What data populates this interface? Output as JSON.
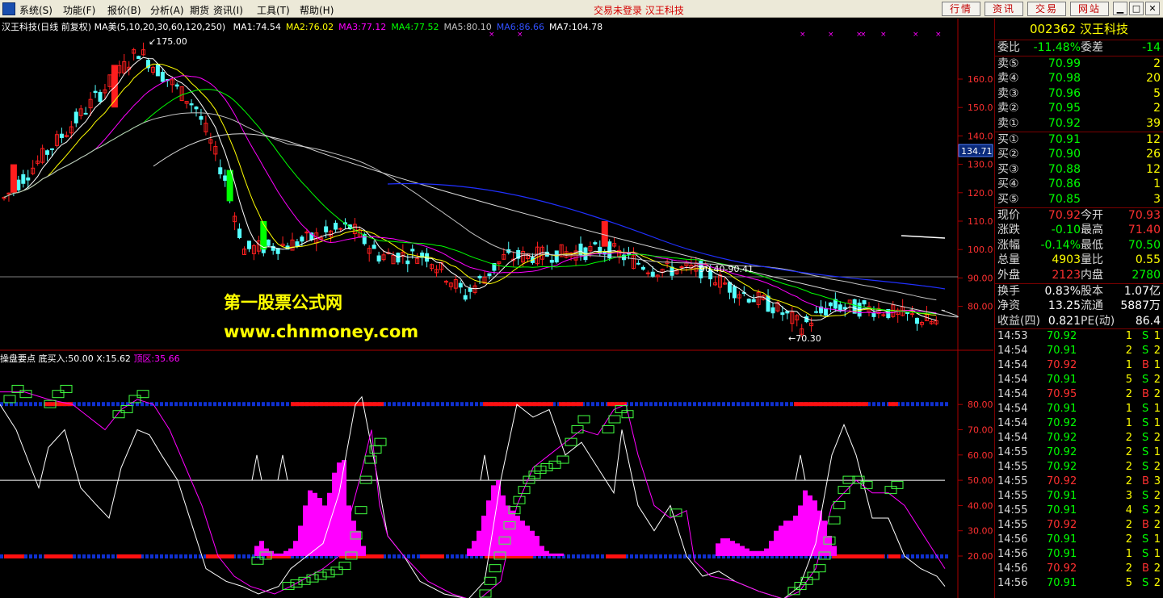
{
  "menu": {
    "items": [
      "系统(S)",
      "功能(F)",
      "报价(B)",
      "分析(A)",
      "期货",
      "资讯(I)",
      "工具(T)",
      "帮助(H)"
    ],
    "status": "交易未登录  汉王科技",
    "buttons": [
      "行情",
      "资讯",
      "交易",
      "网站"
    ]
  },
  "main_chart": {
    "title": "汉王科技(日线 前复权)",
    "ma_label": "MA美(5,10,20,30,60,120,250)",
    "ma_values": [
      {
        "label": "MA1:74.54",
        "color": "#ffffff"
      },
      {
        "label": "MA2:76.02",
        "color": "#ffff00"
      },
      {
        "label": "MA3:77.12",
        "color": "#ff00ff"
      },
      {
        "label": "MA4:77.52",
        "color": "#00ff00"
      },
      {
        "label": "MA5:80.10",
        "color": "#c0c0c0"
      },
      {
        "label": "MA6:86.66",
        "color": "#3050ff"
      },
      {
        "label": "MA7:104.78",
        "color": "#ffffff"
      }
    ],
    "high_marker": "175.00",
    "low_marker": "70.30",
    "band_label": "90.40-90.41",
    "current_price_tag": "134.71",
    "y_ticks": [
      "160.0",
      "150.0",
      "140.0",
      "130.0",
      "120.0",
      "110.0",
      "100.0",
      "90.00",
      "80.00"
    ]
  },
  "indicator": {
    "title": "操盘要点",
    "buy_label": "底买入:50.00",
    "x_label": "X:15.62",
    "top_label": "顶区:35.66",
    "y_ticks": [
      "80.00",
      "70.00",
      "60.00",
      "50.00",
      "40.00",
      "30.00",
      "20.00"
    ]
  },
  "watermark": {
    "line1": "第一股票公式网",
    "line2": "www.chnmoney.com"
  },
  "quote": {
    "code": "002362",
    "name": "汉王科技",
    "ratio": {
      "label": "委比",
      "value": "-11.48%",
      "label2": "委差",
      "value2": "-14"
    },
    "sells": [
      {
        "label": "卖⑤",
        "price": "70.99",
        "vol": "2"
      },
      {
        "label": "卖④",
        "price": "70.98",
        "vol": "20"
      },
      {
        "label": "卖③",
        "price": "70.96",
        "vol": "5"
      },
      {
        "label": "卖②",
        "price": "70.95",
        "vol": "2"
      },
      {
        "label": "卖①",
        "price": "70.92",
        "vol": "39"
      }
    ],
    "buys": [
      {
        "label": "买①",
        "price": "70.91",
        "vol": "12"
      },
      {
        "label": "买②",
        "price": "70.90",
        "vol": "26"
      },
      {
        "label": "买③",
        "price": "70.88",
        "vol": "12"
      },
      {
        "label": "买④",
        "price": "70.86",
        "vol": "1"
      },
      {
        "label": "买⑤",
        "price": "70.85",
        "vol": "3"
      }
    ],
    "stats": [
      {
        "l1": "现价",
        "v1": "70.92",
        "c1": "#ff3030",
        "l2": "今开",
        "v2": "70.93",
        "c2": "#ff3030"
      },
      {
        "l1": "涨跌",
        "v1": "-0.10",
        "c1": "#00ff00",
        "l2": "最高",
        "v2": "71.40",
        "c2": "#ff3030"
      },
      {
        "l1": "涨幅",
        "v1": "-0.14%",
        "c1": "#00ff00",
        "l2": "最低",
        "v2": "70.50",
        "c2": "#00ff00"
      },
      {
        "l1": "总量",
        "v1": "4903",
        "c1": "#ffff00",
        "l2": "量比",
        "v2": "0.55",
        "c2": "#ffff00"
      },
      {
        "l1": "外盘",
        "v1": "2123",
        "c1": "#ff3030",
        "l2": "内盘",
        "v2": "2780",
        "c2": "#00ff00"
      }
    ],
    "stats2": [
      {
        "l1": "换手",
        "v1": "0.83%",
        "l2": "股本",
        "v2": "1.07亿"
      },
      {
        "l1": "净资",
        "v1": "13.25",
        "l2": "流通",
        "v2": "5887万"
      },
      {
        "l1": "收益(四)",
        "v1": "0.821",
        "l2": "PE(动)",
        "v2": "86.4"
      }
    ],
    "ticks": [
      {
        "time": "14:53",
        "price": "70.92",
        "vol": "1",
        "dir": "S",
        "n": "1"
      },
      {
        "time": "14:54",
        "price": "70.91",
        "vol": "2",
        "dir": "S",
        "n": "2"
      },
      {
        "time": "14:54",
        "price": "70.92",
        "vol": "1",
        "dir": "B",
        "n": "1"
      },
      {
        "time": "14:54",
        "price": "70.91",
        "vol": "5",
        "dir": "S",
        "n": "2"
      },
      {
        "time": "14:54",
        "price": "70.95",
        "vol": "2",
        "dir": "B",
        "n": "2"
      },
      {
        "time": "14:54",
        "price": "70.91",
        "vol": "1",
        "dir": "S",
        "n": "1"
      },
      {
        "time": "14:54",
        "price": "70.92",
        "vol": "1",
        "dir": "S",
        "n": "1"
      },
      {
        "time": "14:54",
        "price": "70.92",
        "vol": "2",
        "dir": "S",
        "n": "2"
      },
      {
        "time": "14:55",
        "price": "70.92",
        "vol": "2",
        "dir": "S",
        "n": "1"
      },
      {
        "time": "14:55",
        "price": "70.92",
        "vol": "2",
        "dir": "S",
        "n": "2"
      },
      {
        "time": "14:55",
        "price": "70.92",
        "vol": "2",
        "dir": "B",
        "n": "3"
      },
      {
        "time": "14:55",
        "price": "70.91",
        "vol": "3",
        "dir": "S",
        "n": "2"
      },
      {
        "time": "14:55",
        "price": "70.91",
        "vol": "4",
        "dir": "S",
        "n": "2"
      },
      {
        "time": "14:55",
        "price": "70.92",
        "vol": "2",
        "dir": "B",
        "n": "2"
      },
      {
        "time": "14:56",
        "price": "70.91",
        "vol": "2",
        "dir": "S",
        "n": "1"
      },
      {
        "time": "14:56",
        "price": "70.91",
        "vol": "1",
        "dir": "S",
        "n": "1"
      },
      {
        "time": "14:56",
        "price": "70.92",
        "vol": "2",
        "dir": "B",
        "n": "2"
      },
      {
        "time": "14:56",
        "price": "70.91",
        "vol": "5",
        "dir": "S",
        "n": "2"
      }
    ]
  },
  "colors": {
    "up": "#ff1e1e",
    "down": "#54ffff",
    "green_candle": "#00ff00",
    "frame": "#aa0000",
    "magenta": "#ff00ff",
    "buy": "#ff3030",
    "sell": "#00ff00"
  }
}
